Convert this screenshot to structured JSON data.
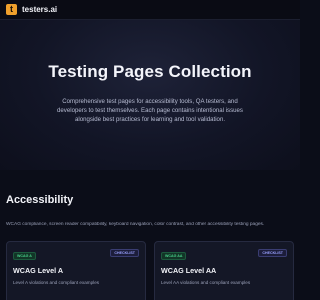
{
  "app": {
    "brand": "testers.ai",
    "logo_glyph": "t"
  },
  "hero": {
    "title": "Testing Pages Collection",
    "description": "Comprehensive test pages for accessibility tools, QA testers, and developers to test themselves. Each page contains intentional issues alongside best practices for learning and tool validation."
  },
  "section": {
    "title": "Accessibility",
    "description": "WCAG compliance, screen reader compatibility, keyboard navigation, color contrast, and other accessibility testing pages."
  },
  "cards": [
    {
      "level": "WCAG A",
      "type": "CHECKLIST",
      "title": "WCAG Level A",
      "description": "Level A violations and compliant examples"
    },
    {
      "level": "WCAG AA",
      "type": "CHECKLIST",
      "title": "WCAG Level AA",
      "description": "Level AA violations and compliant examples"
    }
  ],
  "colors": {
    "accent": "#f0a02c",
    "level_badge": "#49d08a",
    "type_badge": "#9aa2ff"
  }
}
